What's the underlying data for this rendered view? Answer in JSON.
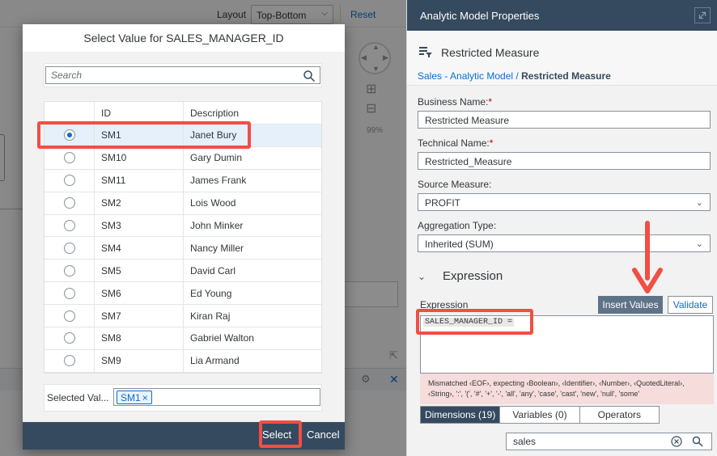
{
  "background": {
    "layout_label": "Layout",
    "layout_value": "Top-Bottom",
    "reset_label": "Reset",
    "zoom_pct": "99%"
  },
  "dialog": {
    "title": "Select Value for SALES_MANAGER_ID",
    "search_placeholder": "Search",
    "columns": {
      "id": "ID",
      "description": "Description"
    },
    "rows": [
      {
        "id": "SM1",
        "description": "Janet Bury",
        "selected": true
      },
      {
        "id": "SM10",
        "description": "Gary Dumin",
        "selected": false
      },
      {
        "id": "SM11",
        "description": "James Frank",
        "selected": false
      },
      {
        "id": "SM2",
        "description": "Lois Wood",
        "selected": false
      },
      {
        "id": "SM3",
        "description": "John Minker",
        "selected": false
      },
      {
        "id": "SM4",
        "description": "Nancy Miller",
        "selected": false
      },
      {
        "id": "SM5",
        "description": "David Carl",
        "selected": false
      },
      {
        "id": "SM6",
        "description": "Ed Young",
        "selected": false
      },
      {
        "id": "SM7",
        "description": "Kiran Raj",
        "selected": false
      },
      {
        "id": "SM8",
        "description": "Gabriel Walton",
        "selected": false
      },
      {
        "id": "SM9",
        "description": "Lia Armand",
        "selected": false
      }
    ],
    "selected_label": "Selected Val...",
    "selected_token": "SM1",
    "select_button": "Select",
    "cancel_button": "Cancel"
  },
  "panel": {
    "title": "Analytic Model Properties",
    "object_name": "Restricted Measure",
    "breadcrumb_link": "Sales - Analytic Model",
    "breadcrumb_sep": " / ",
    "breadcrumb_current": "Restricted Measure",
    "business_name_label": "Business Name:",
    "business_name_value": "Restricted Measure",
    "technical_name_label": "Technical Name:",
    "technical_name_value": "Restricted_Measure",
    "source_measure_label": "Source Measure:",
    "source_measure_value": "PROFIT",
    "aggregation_label": "Aggregation Type:",
    "aggregation_value": "Inherited (SUM)",
    "expression_section": "Expression",
    "expression_label": "Expression",
    "insert_values_button": "Insert Values",
    "validate_button": "Validate",
    "expression_code": "SALES_MANAGER_ID = ",
    "error_text": "Mismatched ‹EOF›, expecting ‹Boolean›, ‹Identifier›, ‹Number›, ‹QuotedLiteral›, ‹String›, ':', '(', '#', '+', '-', 'all', 'any', 'case', 'cast', 'new', 'null', 'some'",
    "tabs": [
      "Dimensions (19)",
      "Variables (0)",
      "Operators"
    ],
    "dimension_search_value": "sales"
  },
  "colors": {
    "shell": "#354a5f",
    "accent": "#0a6ed1",
    "highlight": "#f04f45"
  }
}
